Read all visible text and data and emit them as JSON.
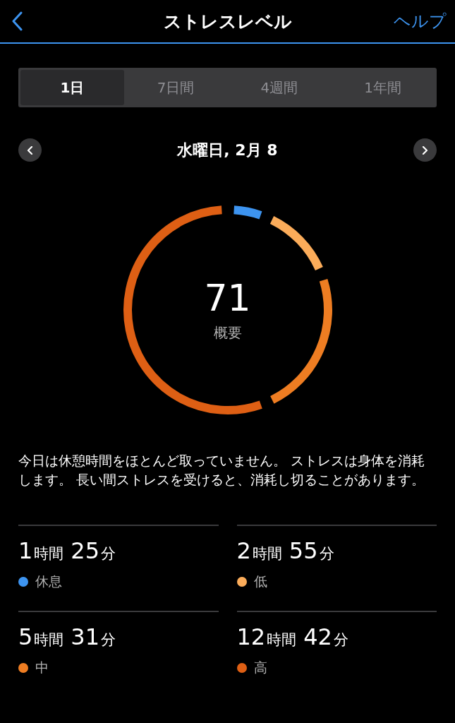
{
  "nav": {
    "title": "ストレスレベル",
    "help": "ヘルプ"
  },
  "tabs": [
    {
      "label": "1日",
      "selected": true
    },
    {
      "label": "7日間",
      "selected": false
    },
    {
      "label": "4週間",
      "selected": false
    },
    {
      "label": "1年間",
      "selected": false
    }
  ],
  "date": {
    "label": "水曜日, 2月 8"
  },
  "summary": {
    "score": "71",
    "caption": "概要"
  },
  "description": "今日は休憩時間をほとんど取っていません。 ストレスは身体を消耗します。 長い間ストレスを受けると、消耗し切ることがあります。",
  "durations": [
    {
      "hours": "1",
      "hours_unit": "時間",
      "minutes": "25",
      "minutes_unit": "分",
      "label": "休息",
      "color": "#3d94f0"
    },
    {
      "hours": "2",
      "hours_unit": "時間",
      "minutes": "55",
      "minutes_unit": "分",
      "label": "低",
      "color": "#fbac5a"
    },
    {
      "hours": "5",
      "hours_unit": "時間",
      "minutes": "31",
      "minutes_unit": "分",
      "label": "中",
      "color": "#ee7d22"
    },
    {
      "hours": "12",
      "hours_unit": "時間",
      "minutes": "42",
      "minutes_unit": "分",
      "label": "高",
      "color": "#de5f14"
    }
  ]
}
